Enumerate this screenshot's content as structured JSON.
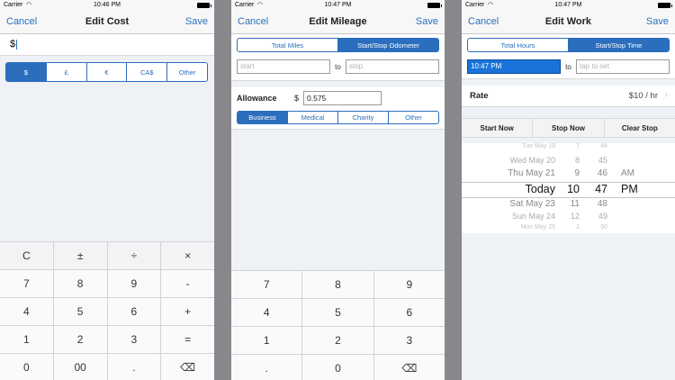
{
  "screens": [
    {
      "status": {
        "carrier": "Carrier",
        "time": "10:46 PM"
      },
      "nav": {
        "left": "Cancel",
        "title": "Edit Cost",
        "right": "Save"
      },
      "amount": "$",
      "currencies": [
        "$",
        "£",
        "€",
        "CA$",
        "Other"
      ],
      "currency_selected": 0,
      "keypad": [
        [
          "C",
          "±",
          "÷",
          "×"
        ],
        [
          "7",
          "8",
          "9",
          "-"
        ],
        [
          "4",
          "5",
          "6",
          "+"
        ],
        [
          "1",
          "2",
          "3",
          "="
        ],
        [
          "0",
          "00",
          ".",
          "⌫"
        ]
      ]
    },
    {
      "status": {
        "carrier": "Carrier",
        "time": "10:47 PM"
      },
      "nav": {
        "left": "Cancel",
        "title": "Edit Mileage",
        "right": "Save"
      },
      "mode_tabs": [
        "Total Miles",
        "Start/Stop Odometer"
      ],
      "mode_selected": 1,
      "range": {
        "start_placeholder": "start",
        "to": "to",
        "stop_placeholder": "stop"
      },
      "allowance": {
        "label": "Allowance",
        "currency": "$",
        "value": "0.575"
      },
      "purposes": [
        "Business",
        "Medical",
        "Charity",
        "Other"
      ],
      "purpose_selected": 0,
      "keypad": [
        [
          "7",
          "8",
          "9"
        ],
        [
          "4",
          "5",
          "6"
        ],
        [
          "1",
          "2",
          "3"
        ],
        [
          ".",
          "0",
          "⌫"
        ]
      ]
    },
    {
      "status": {
        "carrier": "Carrier",
        "time": "10:47 PM"
      },
      "nav": {
        "left": "Cancel",
        "title": "Edit Work",
        "right": "Save"
      },
      "mode_tabs": [
        "Total Hours",
        "Start/Stop Time"
      ],
      "mode_selected": 1,
      "range": {
        "start_value": "10:47 PM",
        "to": "to",
        "stop_placeholder": "tap to set"
      },
      "rate": {
        "label": "Rate",
        "value": "$10 / hr"
      },
      "actions": [
        "Start Now",
        "Stop Now",
        "Clear Stop"
      ],
      "picker": {
        "rows": [
          {
            "date": "Tue May 19",
            "hour": "7",
            "minute": "44",
            "ampm": ""
          },
          {
            "date": "Wed May 20",
            "hour": "8",
            "minute": "45",
            "ampm": ""
          },
          {
            "date": "Thu May 21",
            "hour": "9",
            "minute": "46",
            "ampm": "AM"
          },
          {
            "date": "Today",
            "hour": "10",
            "minute": "47",
            "ampm": "PM"
          },
          {
            "date": "Sat May 23",
            "hour": "11",
            "minute": "48",
            "ampm": ""
          },
          {
            "date": "Sun May 24",
            "hour": "12",
            "minute": "49",
            "ampm": ""
          },
          {
            "date": "Mon May 25",
            "hour": "1",
            "minute": "50",
            "ampm": ""
          }
        ],
        "selected_index": 3
      }
    }
  ],
  "colors": {
    "accent": "#2a6ebd",
    "active_field": "#1a73d9",
    "background": "#eef1f6"
  }
}
